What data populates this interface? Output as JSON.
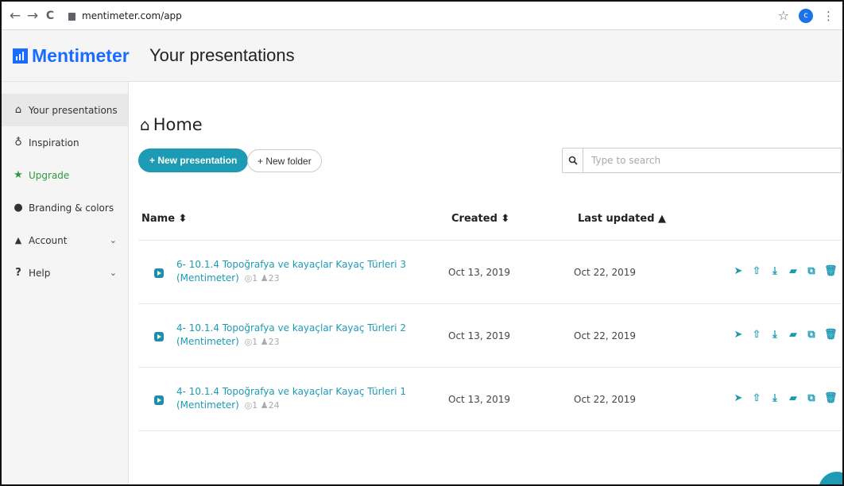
{
  "browser": {
    "back": "←",
    "forward": "→",
    "reload": "C",
    "url": "mentimeter.com/app",
    "bookmark": "☆",
    "profile_initial": "c",
    "menu": "⋮"
  },
  "app": {
    "logo_text": "Mentimeter",
    "page_title": "Your presentations"
  },
  "sidebar": {
    "items": [
      {
        "label": "Your presentations",
        "icon": "home-icon",
        "glyph": "⌂"
      },
      {
        "label": "Inspiration",
        "icon": "lightbulb-icon",
        "glyph": "♁"
      },
      {
        "label": "Upgrade",
        "icon": "star-icon",
        "glyph": "★"
      },
      {
        "label": "Branding & colors",
        "icon": "drop-icon",
        "glyph": "●"
      },
      {
        "label": "Account",
        "icon": "user-icon",
        "glyph": "▲",
        "chevron": "⌄"
      },
      {
        "label": "Help",
        "icon": "question-icon",
        "glyph": "?",
        "chevron": "⌄"
      }
    ]
  },
  "main": {
    "home_label": "Home",
    "home_glyph": "⌂",
    "new_presentation": "+ New presentation",
    "new_folder": "+ New folder",
    "search_placeholder": "Type to search",
    "search_icon": "search-icon",
    "columns": {
      "name": "Name ⬍",
      "created": "Created ⬍",
      "updated": "Last updated ▲"
    },
    "rows": [
      {
        "title": "6- 10.1.4 Topoğrafya ve kayaçlar Kayaç Türleri 3 (Mentimeter)",
        "meta": "◎1 ♟23",
        "created": "Oct 13, 2019",
        "updated": "Oct 22, 2019"
      },
      {
        "title": "4- 10.1.4 Topoğrafya ve kayaçlar Kayaç Türleri 2 (Mentimeter)",
        "meta": "◎1 ♟23",
        "created": "Oct 13, 2019",
        "updated": "Oct 22, 2019"
      },
      {
        "title": "4- 10.1.4 Topoğrafya ve kayaçlar Kayaç Türleri 1 (Mentimeter)",
        "meta": "◎1 ♟24",
        "created": "Oct 13, 2019",
        "updated": "Oct 22, 2019"
      }
    ],
    "row_actions": [
      {
        "name": "present-icon",
        "glyph": "➤"
      },
      {
        "name": "share-icon",
        "glyph": "⇧"
      },
      {
        "name": "download-icon",
        "glyph": "⤓"
      },
      {
        "name": "move-folder-icon",
        "glyph": "▰"
      },
      {
        "name": "duplicate-icon",
        "glyph": "⧉"
      },
      {
        "name": "delete-icon",
        "glyph": "🗑"
      }
    ]
  },
  "colors": {
    "brand": "#196cff",
    "accent": "#1e9bb4",
    "upgrade": "#2e9a3c"
  }
}
